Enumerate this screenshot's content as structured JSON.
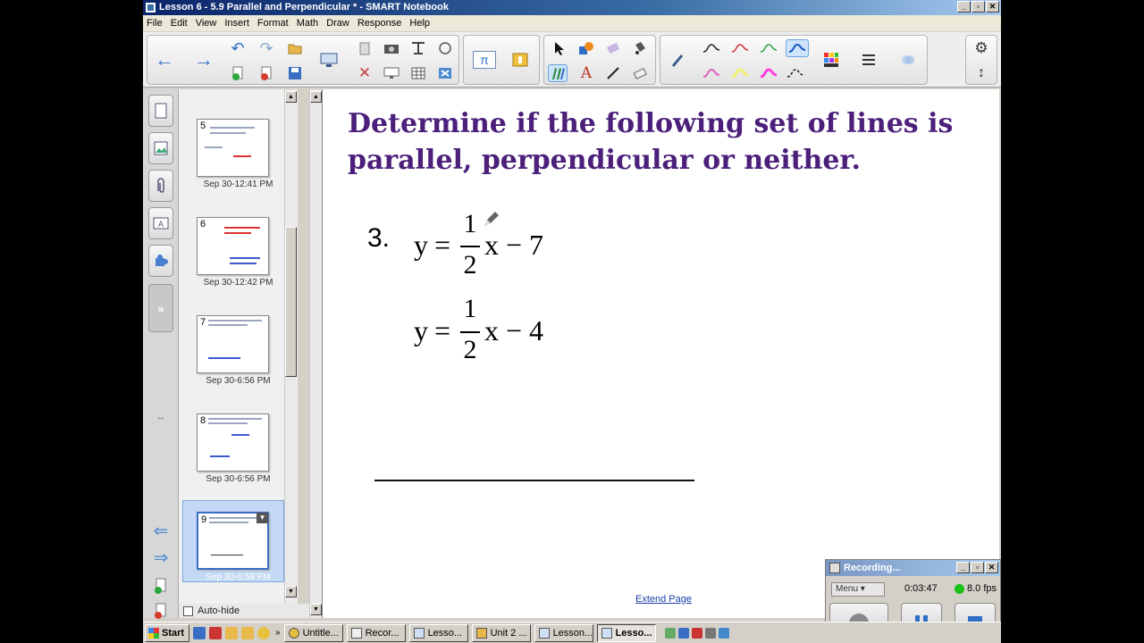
{
  "window": {
    "title": "Lesson 6 - 5.9 Parallel and Perpendicular * - SMART Notebook",
    "min": "_",
    "max": "▫",
    "close": "✕"
  },
  "menu": [
    "File",
    "Edit",
    "View",
    "Insert",
    "Format",
    "Math",
    "Draw",
    "Response",
    "Help"
  ],
  "toolbar": {
    "back_icon": "←",
    "forward_icon": "→",
    "undo_icon": "↶",
    "redo_icon": "↷",
    "math_label": "π",
    "gear_icon": "⚙",
    "move_icon": "↕"
  },
  "sidetabs": [
    "page-sorter",
    "gallery",
    "attachments",
    "properties",
    "addons"
  ],
  "thumbnails": [
    {
      "num": "5",
      "date": "Sep 30-12:41 PM"
    },
    {
      "num": "6",
      "date": "Sep 30-12:42 PM"
    },
    {
      "num": "7",
      "date": "Sep 30-6:56 PM"
    },
    {
      "num": "8",
      "date": "Sep 30-6:56 PM"
    },
    {
      "num": "9",
      "date": "Sep 30-6:58 PM"
    }
  ],
  "autohide_label": "Auto-hide",
  "page": {
    "heading_line1": "Determine if the following set of lines is",
    "heading_line2": "parallel, perpendicular or neither.",
    "problem_number": "3.",
    "eq1": {
      "lhs": "y",
      "num": "1",
      "den": "2",
      "rest": "x − 7"
    },
    "eq2": {
      "lhs": "y",
      "num": "1",
      "den": "2",
      "rest": "x − 4"
    },
    "extend_link": "Extend Page"
  },
  "recorder": {
    "title": "Recording...",
    "menu": "Menu",
    "time": "0:03:47",
    "fps": "8.0 fps"
  },
  "taskbar": {
    "start": "Start",
    "tasks": [
      "Untitle...",
      "Recor...",
      "Lesso...",
      "Unit 2 ...",
      "Lesson...",
      "Lesso..."
    ]
  },
  "colors": {
    "heading": "#4b1f7a",
    "title_bar": "#0a246a",
    "link": "#1a3fa8"
  }
}
